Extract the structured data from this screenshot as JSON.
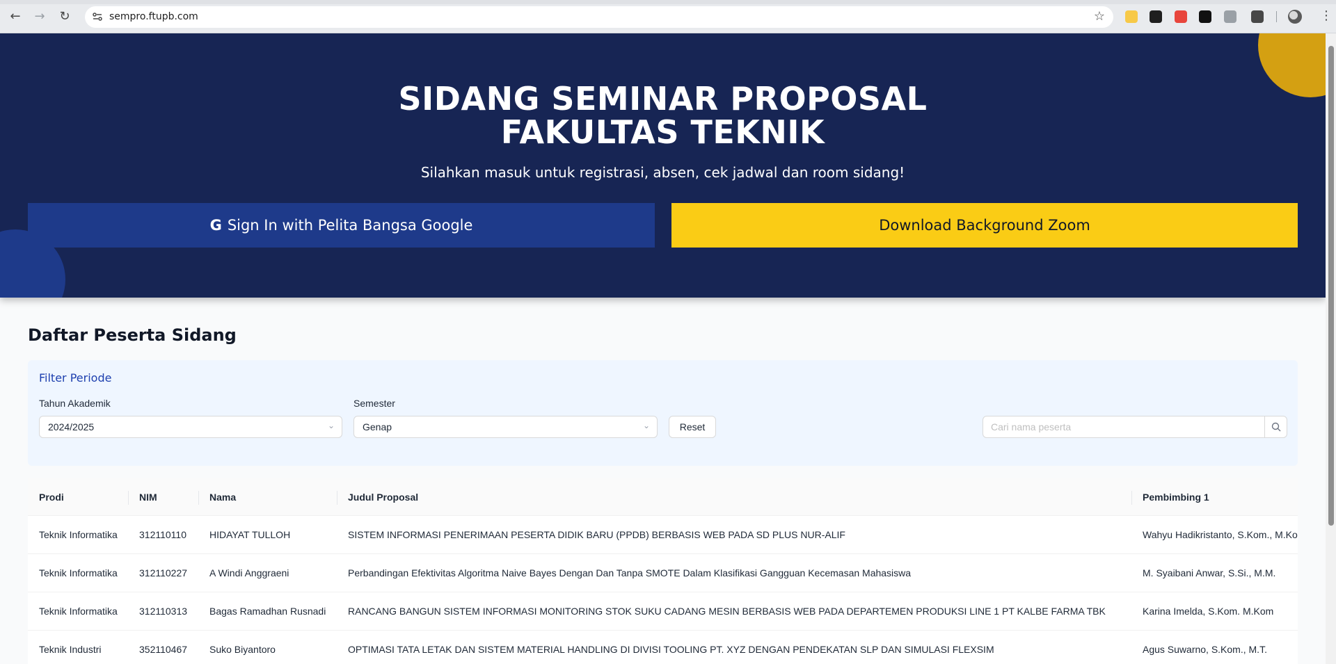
{
  "browser": {
    "url": "sempro.ftupb.com",
    "extensions": [
      {
        "icon": "note-extension-icon",
        "color": "#f7c948"
      },
      {
        "icon": "pen-extension-icon",
        "color": "#1f1f1f"
      },
      {
        "icon": "record-extension-icon",
        "color": "#e8453c"
      },
      {
        "icon": "p-extension-icon",
        "color": "#111111"
      },
      {
        "icon": "camera-extension-icon",
        "color": "#9aa0a6"
      },
      {
        "icon": "puzzle-extension-icon",
        "color": "#474747"
      }
    ]
  },
  "hero": {
    "title_line1": "SIDANG SEMINAR PROPOSAL",
    "title_line2": "FAKULTAS TEKNIK",
    "subtitle": "Silahkan masuk untuk registrasi, absen, cek jadwal dan room sidang!",
    "signin_label": "Sign In with Pelita Bangsa Google",
    "download_label": "Download Background Zoom",
    "colors": {
      "background": "#172554",
      "signin": "#1e3a8a",
      "download": "#facc15"
    }
  },
  "main": {
    "section_title": "Daftar Peserta Sidang",
    "filter": {
      "title": "Filter Periode",
      "year_label": "Tahun Akademik",
      "year_value": "2024/2025",
      "semester_label": "Semester",
      "semester_value": "Genap",
      "reset_label": "Reset",
      "search_placeholder": "Cari nama peserta"
    },
    "table": {
      "headers": [
        "Prodi",
        "NIM",
        "Nama",
        "Judul Proposal",
        "Pembimbing 1"
      ],
      "rows": [
        [
          "Teknik Informatika",
          "312110110",
          "HIDAYAT TULLOH",
          "SISTEM INFORMASI PENERIMAAN PESERTA DIDIK BARU (PPDB) BERBASIS WEB PADA SD PLUS NUR-ALIF",
          "Wahyu Hadikristanto, S.Kom., M.Kom"
        ],
        [
          "Teknik Informatika",
          "312110227",
          "A Windi Anggraeni",
          "Perbandingan Efektivitas Algoritma Naive Bayes Dengan Dan Tanpa SMOTE Dalam Klasifikasi Gangguan Kecemasan Mahasiswa",
          "M. Syaibani Anwar, S.Si., M.M."
        ],
        [
          "Teknik Informatika",
          "312110313",
          "Bagas Ramadhan Rusnadi",
          "RANCANG BANGUN SISTEM INFORMASI MONITORING STOK SUKU CADANG MESIN BERBASIS WEB PADA DEPARTEMEN PRODUKSI LINE 1 PT KALBE FARMA TBK",
          "Karina Imelda, S.Kom. M.Kom"
        ],
        [
          "Teknik Industri",
          "352110467",
          "Suko Biyantoro",
          "OPTIMASI TATA LETAK DAN SISTEM MATERIAL HANDLING DI DIVISI TOOLING PT. XYZ DENGAN PENDEKATAN SLP DAN SIMULASI FLEXSIM",
          "Agus Suwarno, S.Kom., M.T."
        ]
      ]
    }
  }
}
